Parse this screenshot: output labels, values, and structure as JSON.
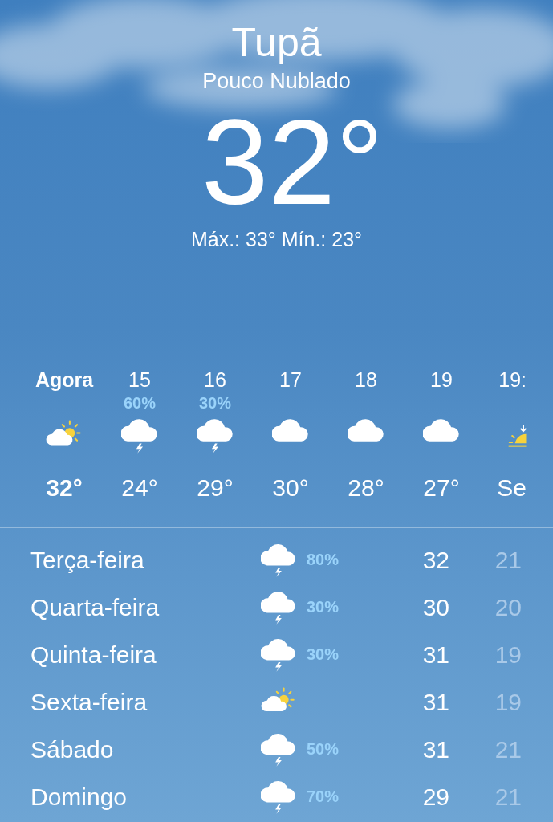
{
  "location": {
    "city": "Tupã",
    "condition": "Pouco Nublado",
    "temperature": "32°",
    "high_low": "Máx.: 33° Mín.: 23°"
  },
  "hourly": [
    {
      "time": "Agora",
      "kind": "partly-cloudy",
      "temp": "32°",
      "now": true
    },
    {
      "time": "15",
      "precip": "60%",
      "kind": "thunderstorm",
      "temp": "24°",
      "now": false
    },
    {
      "time": "16",
      "precip": "30%",
      "kind": "thunderstorm",
      "temp": "29°",
      "now": false
    },
    {
      "time": "17",
      "kind": "cloudy",
      "temp": "30°",
      "now": false
    },
    {
      "time": "18",
      "kind": "cloudy",
      "temp": "28°",
      "now": false
    },
    {
      "time": "19",
      "kind": "cloudy",
      "temp": "27°",
      "now": false
    },
    {
      "time": "19:",
      "kind": "sunset",
      "temp": "Se",
      "now": false
    }
  ],
  "daily": [
    {
      "day": "Terça-feira",
      "kind": "thunderstorm",
      "precip": "80%",
      "high": "32",
      "low": "21"
    },
    {
      "day": "Quarta-feira",
      "kind": "thunderstorm",
      "precip": "30%",
      "high": "30",
      "low": "20"
    },
    {
      "day": "Quinta-feira",
      "kind": "thunderstorm",
      "precip": "30%",
      "high": "31",
      "low": "19"
    },
    {
      "day": "Sexta-feira",
      "kind": "partly-cloudy",
      "high": "31",
      "low": "19"
    },
    {
      "day": "Sábado",
      "kind": "thunderstorm",
      "precip": "50%",
      "high": "31",
      "low": "21"
    },
    {
      "day": "Domingo",
      "kind": "thunderstorm",
      "precip": "70%",
      "high": "29",
      "low": "21"
    }
  ]
}
